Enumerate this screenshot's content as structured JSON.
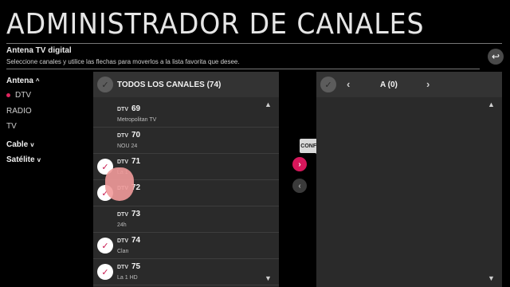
{
  "header": {
    "title": "ADMINISTRADOR DE CANALES",
    "subtitle": "Antena TV digital",
    "hint": "Seleccione canales y utilice las flechas para moverlos a la lista favorita que desee.",
    "back_icon": "↩"
  },
  "sidebar": {
    "antena": {
      "label": "Antena",
      "chevron": "^"
    },
    "dtv": {
      "label": "DTV"
    },
    "radio": {
      "label": "RADIO"
    },
    "tv": {
      "label": "TV"
    },
    "cable": {
      "label": "Cable",
      "chevron": "v"
    },
    "satelite": {
      "label": "Satélite",
      "chevron": "v"
    }
  },
  "left_panel": {
    "header": "TODOS LOS CANALES (74)",
    "channels": [
      {
        "type": "DTV",
        "number": "69",
        "name": "Metropolitan TV",
        "checked": false
      },
      {
        "type": "DTV",
        "number": "70",
        "name": "NOU 24",
        "checked": false
      },
      {
        "type": "DTV",
        "number": "71",
        "name": "La 1",
        "checked": true
      },
      {
        "type": "DTV",
        "number": "72",
        "name": "",
        "checked": true
      },
      {
        "type": "DTV",
        "number": "73",
        "name": "24h",
        "checked": false
      },
      {
        "type": "DTV",
        "number": "74",
        "name": "Clan",
        "checked": true
      },
      {
        "type": "DTV",
        "number": "75",
        "name": "La 1 HD",
        "checked": true
      }
    ]
  },
  "right_panel": {
    "header": "A (0)",
    "prev_icon": "‹",
    "next_icon": "›"
  },
  "tooltip": {
    "label": "CONFIGURAR"
  },
  "move_right_icon": "›",
  "move_left_icon": "‹",
  "checkmark": "✓",
  "colors": {
    "accent": "#d6175b",
    "panel": "#2a2a2a"
  }
}
